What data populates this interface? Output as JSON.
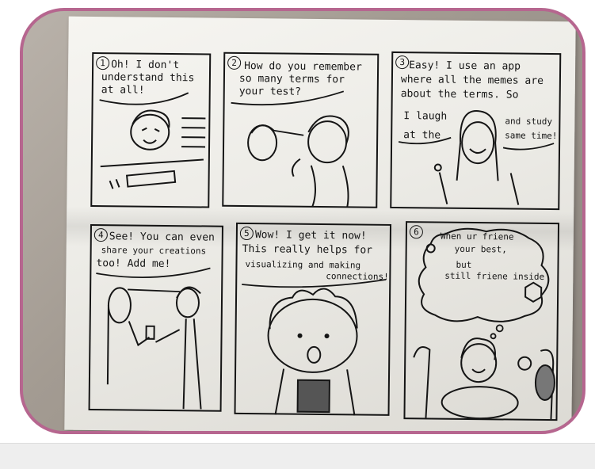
{
  "comic": {
    "panels": [
      {
        "number": "1",
        "lines": [
          "Oh! I don't",
          "understand this",
          "at all!"
        ]
      },
      {
        "number": "2",
        "lines": [
          "How do you remember",
          "so many terms for",
          "your test?"
        ]
      },
      {
        "number": "3",
        "lines": [
          "Easy! I use an app",
          "where all the memes are",
          "about the terms. So"
        ],
        "left_lines": [
          "I laugh",
          "at the"
        ],
        "right_lines": [
          "and study",
          "same time!"
        ]
      },
      {
        "number": "4",
        "lines": [
          "See! You can even",
          "share your creations",
          "too! Add me!"
        ]
      },
      {
        "number": "5",
        "lines": [
          "Wow! I get it now!",
          "This really helps for",
          "visualizing and making",
          "connections!"
        ]
      },
      {
        "number": "6",
        "lines": [
          "When ur friene",
          "your best,",
          "but",
          "still friene inside"
        ]
      }
    ]
  }
}
